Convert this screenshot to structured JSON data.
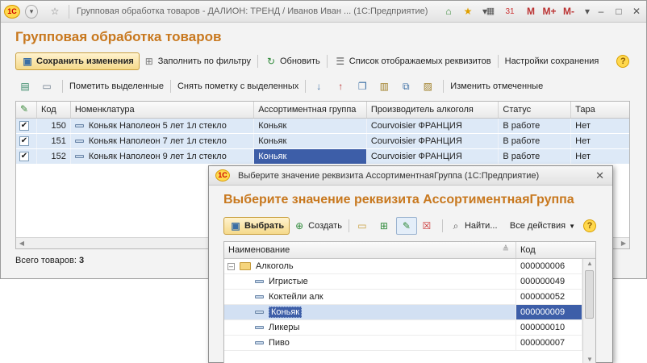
{
  "window": {
    "title": "Групповая обработка товаров - ДАЛИОН: ТРЕНД / Иванов Иван ... (1С:Предприятие)",
    "logo_text": "1С",
    "right_buttons": [
      "M",
      "M+",
      "M-"
    ]
  },
  "form": {
    "title": "Групповая обработка товаров",
    "toolbar1": {
      "save": "Сохранить изменения",
      "fill_by_filter": "Заполнить по фильтру",
      "refresh": "Обновить",
      "attributes_list": "Список отображаемых реквизитов",
      "save_settings": "Настройки сохранения",
      "help": "?"
    },
    "toolbar2": {
      "mark_selected": "Пометить выделенные",
      "unmark_selected": "Снять пометку с выделенных",
      "change_marked": "Изменить отмеченные"
    },
    "table": {
      "columns": [
        "Код",
        "Номенклатура",
        "Ассортиментная группа",
        "Производитель алкоголя",
        "Статус",
        "Тара"
      ],
      "rows": [
        {
          "checked": true,
          "kod": "150",
          "nom": "Коньяк Наполеон 5 лет 1л стекло",
          "group": "Коньяк",
          "producer": "Courvoisier  ФРАНЦИЯ",
          "status": "В работе",
          "tara": "Нет"
        },
        {
          "checked": true,
          "kod": "151",
          "nom": "Коньяк Наполеон 7 лет 1л стекло",
          "group": "Коньяк",
          "producer": "Courvoisier  ФРАНЦИЯ",
          "status": "В работе",
          "tara": "Нет"
        },
        {
          "checked": true,
          "kod": "152",
          "nom": "Коньяк Наполеон 9 лет 1л стекло",
          "group": "Коньяк",
          "producer": "Courvoisier  ФРАНЦИЯ",
          "status": "В работе",
          "tara": "Нет"
        }
      ]
    },
    "footer": {
      "label": "Всего товаров:",
      "count": "3"
    }
  },
  "dialog": {
    "window_title": "Выберите значение реквизита АссортиментнаяГруппа  (1С:Предприятие)",
    "heading": "Выберите значение реквизита АссортиментнаяГруппа",
    "toolbar": {
      "select": "Выбрать",
      "create": "Создать",
      "find": "Найти...",
      "all_actions": "Все действия",
      "help": "?"
    },
    "table": {
      "columns": [
        "Наименование",
        "Код"
      ],
      "rows": [
        {
          "name": "Алкоголь",
          "kod": "000000006",
          "type": "folder",
          "selected": false
        },
        {
          "name": "Игристые",
          "kod": "000000049",
          "type": "item",
          "selected": false
        },
        {
          "name": "Коктейли алк",
          "kod": "000000052",
          "type": "item",
          "selected": false
        },
        {
          "name": "Коньяк",
          "kod": "000000009",
          "type": "item",
          "selected": true
        },
        {
          "name": "Ликеры",
          "kod": "000000010",
          "type": "item",
          "selected": false
        },
        {
          "name": "Пиво",
          "kod": "000000007",
          "type": "item",
          "selected": false
        }
      ]
    }
  },
  "colors": {
    "title_accent": "#c8781e",
    "row_highlight": "#dde9f7",
    "selection": "#3d5ea8"
  }
}
